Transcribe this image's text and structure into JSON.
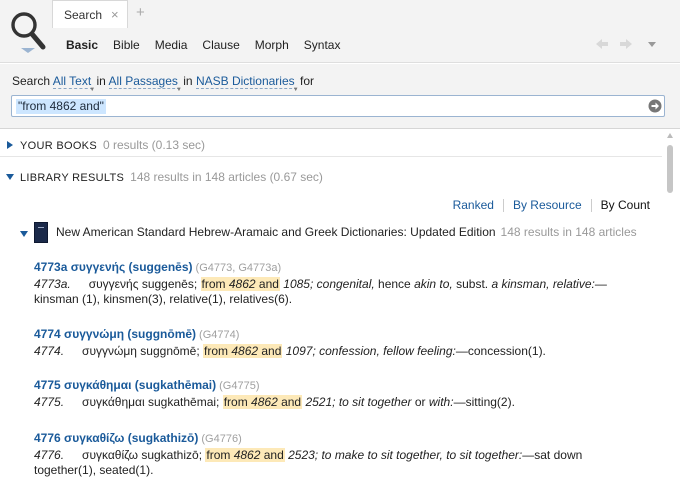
{
  "tab": {
    "label": "Search",
    "close_glyph": "×",
    "add_glyph": "+"
  },
  "subtabs": [
    "Basic",
    "Bible",
    "Media",
    "Clause",
    "Morph",
    "Syntax"
  ],
  "search": {
    "prefix": "Search",
    "scope1": "All Text",
    "in1": "in",
    "scope2": "All Passages",
    "in2": "in",
    "scope3": "NASB Dictionaries",
    "suffix": "for",
    "query": "\"from 4862 and\""
  },
  "your_books": {
    "title": "YOUR BOOKS",
    "summary": "0 results (0.13 sec)"
  },
  "library": {
    "title": "LIBRARY RESULTS",
    "summary": "148 results in 148 articles (0.67 sec)"
  },
  "sort_options": [
    "Ranked",
    "By Resource",
    "By Count"
  ],
  "resource": {
    "title": "New American Standard Hebrew-Aramaic and Greek Dictionaries: Updated Edition",
    "count": "148 results in 148 articles"
  },
  "entries": [
    {
      "title": "4773a συγγενής (suggenēs)",
      "refs": "(G4773, G4773a)",
      "body": [
        [
          "num",
          "4773a."
        ],
        [
          "t",
          "συγγενής suggenēs; "
        ],
        [
          "hl",
          "from ",
          [
            "it",
            "4862"
          ],
          " and"
        ],
        [
          "t",
          " "
        ],
        [
          "it",
          "1085; congenital,"
        ],
        [
          "t",
          " hence "
        ],
        [
          "it",
          "akin to,"
        ],
        [
          "t",
          " subst. "
        ],
        [
          "it",
          "a kinsman, relative:"
        ],
        [
          "t",
          "—kinsman (1), kinsmen(3), relative(1), relatives(6)."
        ]
      ]
    },
    {
      "title": "4774 συγγνώμη (suggnōmē)",
      "refs": "(G4774)",
      "body": [
        [
          "num",
          "4774."
        ],
        [
          "t",
          "συγγνώμη suggnōmē; "
        ],
        [
          "hl",
          "from ",
          [
            "it",
            "4862"
          ],
          " and"
        ],
        [
          "t",
          " "
        ],
        [
          "it",
          "1097; confession, fellow feeling:"
        ],
        [
          "t",
          "—concession(1)."
        ]
      ]
    },
    {
      "title": "4775 συγκάθημαι (sugkathēmai)",
      "refs": "(G4775)",
      "body": [
        [
          "num",
          "4775."
        ],
        [
          "t",
          "συγκάθημαι sugkathēmai; "
        ],
        [
          "hl",
          "from ",
          [
            "it",
            "4862"
          ],
          " and"
        ],
        [
          "t",
          " "
        ],
        [
          "it",
          "2521; to sit together"
        ],
        [
          "t",
          " or "
        ],
        [
          "it",
          "with:"
        ],
        [
          "t",
          "—sitting(2)."
        ]
      ]
    },
    {
      "title": "4776 συγκαθίζω (sugkathizō)",
      "refs": "(G4776)",
      "body": [
        [
          "num",
          "4776."
        ],
        [
          "t",
          "συγκαθίζω sugkathizō; "
        ],
        [
          "hl",
          "from ",
          [
            "it",
            "4862"
          ],
          " and"
        ],
        [
          "t",
          " "
        ],
        [
          "it",
          "2523; to make to sit together, to sit together:"
        ],
        [
          "t",
          "—sat down together(1), seated(1)."
        ]
      ]
    }
  ],
  "colors": {
    "link": "#1a5a9a",
    "highlight": "#fde9b8",
    "query_selection": "#cde6ff"
  },
  "icons": [
    "search-icon",
    "close-icon",
    "plus-icon",
    "back-arrow-icon",
    "forward-arrow-icon",
    "menu-caret-icon",
    "go-arrow-icon",
    "expand-triangle-icon",
    "collapse-triangle-icon",
    "book-icon"
  ]
}
